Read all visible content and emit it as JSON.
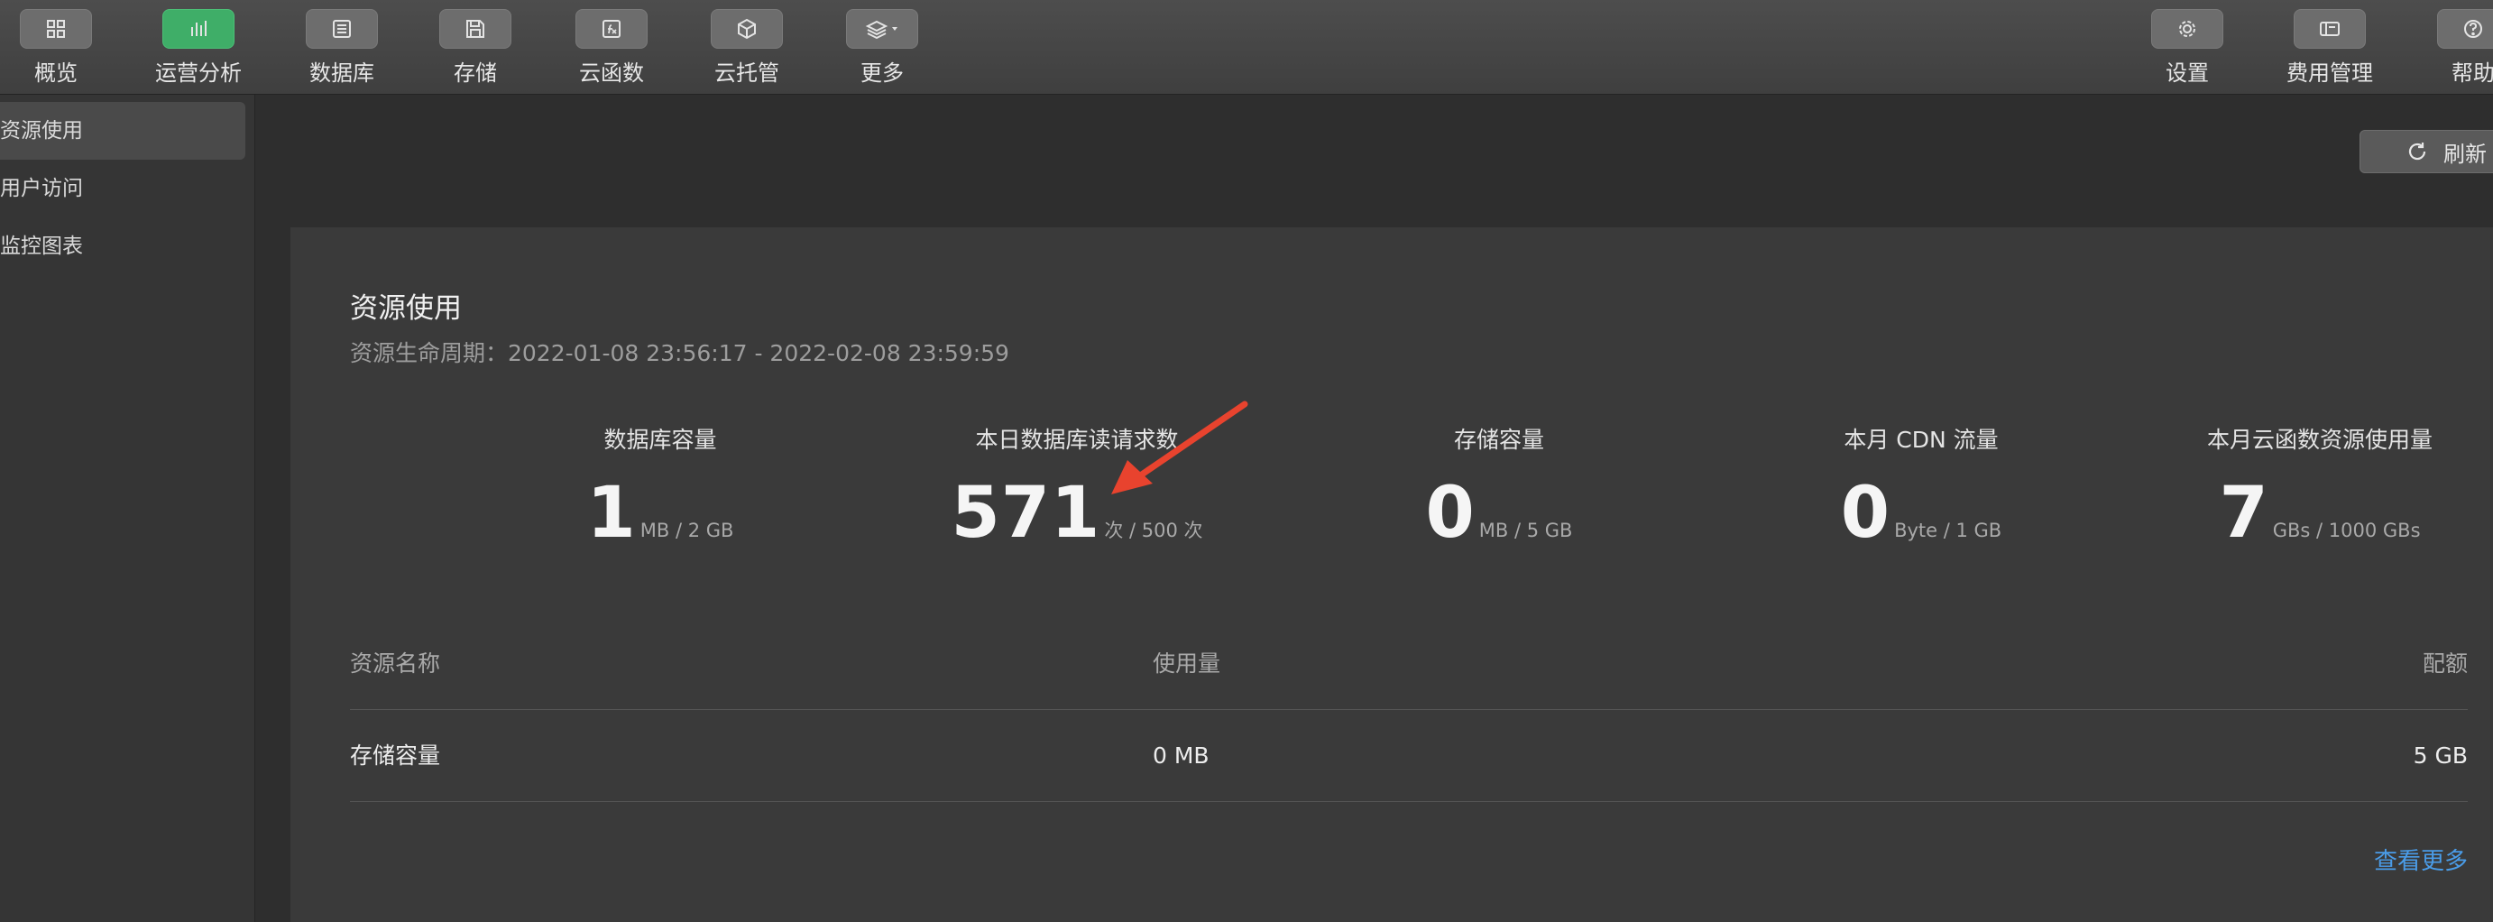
{
  "toolbar": {
    "left": [
      {
        "label": "概览",
        "icon": "grid-icon"
      },
      {
        "label": "运营分析",
        "icon": "bar-chart-icon",
        "active": true
      },
      {
        "label": "数据库",
        "icon": "database-icon"
      },
      {
        "label": "存储",
        "icon": "save-icon"
      },
      {
        "label": "云函数",
        "icon": "function-icon"
      },
      {
        "label": "云托管",
        "icon": "cube-icon"
      },
      {
        "label": "更多",
        "icon": "layers-icon"
      }
    ],
    "right": [
      {
        "label": "设置",
        "icon": "gear-icon"
      },
      {
        "label": "费用管理",
        "icon": "billing-icon"
      },
      {
        "label": "帮助",
        "icon": "help-icon"
      }
    ],
    "active_color": "#3fae68"
  },
  "sidebar": {
    "items": [
      {
        "label": "资源使用",
        "active": true
      },
      {
        "label": "用户访问"
      },
      {
        "label": "监控图表"
      }
    ]
  },
  "refresh_label": "刷新",
  "card": {
    "title": "资源使用",
    "subtitle": "资源生命周期：2022-01-08 23:56:17 - 2022-02-08 23:59:59",
    "stats": [
      {
        "label": "数据库容量",
        "value": "1",
        "unit": "MB / 2 GB"
      },
      {
        "label": "本日数据库读请求数",
        "value": "571",
        "unit": "次 / 500 次"
      },
      {
        "label": "存储容量",
        "value": "0",
        "unit": "MB / 5 GB"
      },
      {
        "label": "本月 CDN 流量",
        "value": "0",
        "unit": "Byte / 1 GB"
      },
      {
        "label": "本月云函数资源使用量",
        "value": "7",
        "unit": "GBs / 1000 GBs"
      }
    ],
    "table": {
      "headers": [
        "资源名称",
        "使用量",
        "配额"
      ],
      "rows": [
        [
          "存储容量",
          "0 MB",
          "5 GB"
        ]
      ]
    },
    "more_label": "查看更多",
    "annotation_color": "#e8432e",
    "link_color": "#4a9ce8"
  }
}
